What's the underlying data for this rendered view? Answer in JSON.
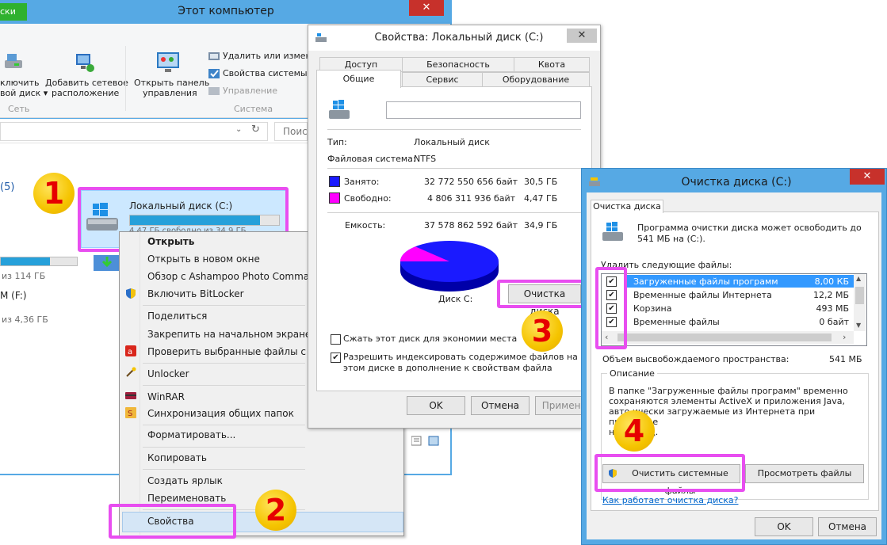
{
  "explorer": {
    "title": "Этот компьютер",
    "tab_partial": "ски",
    "ribbon": {
      "connect_label_1": "ключить",
      "connect_label_2": "вой диск ▾",
      "add_location_1": "Добавить сетевое",
      "add_location_2": "расположение",
      "open_panel_1": "Открыть панель",
      "open_panel_2": "управления",
      "uninstall": "Удалить или измени",
      "sys_props": "Свойства системы",
      "manage": "Управление",
      "group_net": "Сеть",
      "group_sys": "Система"
    },
    "search_placeholder": "Поис",
    "drives_count": "(5)",
    "drive_c_name": "Локальный диск (C:)",
    "drive_c_free": "4,47 ГБ свободно из 34,9 ГБ",
    "drive_left_free1": "из 114 ГБ",
    "drive_f": "M (F:)",
    "drive_left_free2": "из 4,36 ГБ"
  },
  "context_menu": {
    "items": [
      "Открыть",
      "Открыть в новом окне",
      "Обзор с Ashampoo Photo Command",
      "Включить BitLocker",
      "Поделиться",
      "Закрепить на начальном экране",
      "Проверить выбранные файлы с пом",
      "Unlocker",
      "WinRAR",
      "Синхронизация общих папок",
      "Форматировать...",
      "Копировать",
      "Создать ярлык",
      "Переименовать",
      "Свойства"
    ]
  },
  "properties": {
    "title": "Свойства: Локальный диск (C:)",
    "tabs": [
      "Доступ",
      "Безопасность",
      "Квота",
      "Общие",
      "Сервис",
      "Оборудование"
    ],
    "type_label": "Тип:",
    "type_value": "Локальный диск",
    "fs_label": "Файловая система:",
    "fs_value": "NTFS",
    "used_label": "Занято:",
    "used_bytes": "32 772 550 656 байт",
    "used_gb": "30,5 ГБ",
    "free_label": "Свободно:",
    "free_bytes": "4 806 311 936 байт",
    "free_gb": "4,47 ГБ",
    "capacity_label": "Емкость:",
    "capacity_bytes": "37 578 862 592 байт",
    "capacity_gb": "34,9 ГБ",
    "disk_label": "Диск C:",
    "cleanup_button": "Очистка диска",
    "compress_label": "Сжать этот диск для экономии места",
    "index_label": "Разрешить индексировать содержимое файлов на этом диске в дополнение к свойствам файла",
    "ok": "OK",
    "cancel": "Отмена",
    "apply": "Примени",
    "used_fraction": 0.872,
    "colors": {
      "used": "#1a1aff",
      "free": "#ff00ff"
    }
  },
  "cleanup": {
    "title": "Очистка диска  (C:)",
    "tab": "Очистка диска",
    "intro": "Программа очистки диска может освободить до 541 МБ на  (C:).",
    "delete_label": "Удалить следующие файлы:",
    "files": [
      {
        "name": "Загруженные файлы программ",
        "size": "8,00 КБ",
        "checked": "✔"
      },
      {
        "name": "Временные файлы Интернета",
        "size": "12,2 МБ",
        "checked": "✔"
      },
      {
        "name": "Корзина",
        "size": "493 МБ",
        "checked": "✔"
      },
      {
        "name": "Временные файлы",
        "size": "0 байт",
        "checked": "✔"
      }
    ],
    "total_label": "Объем высвобождаемого пространства:",
    "total_value": "541 МБ",
    "desc_title": "Описание",
    "desc_line1": "В папке \"Загруженные файлы программ\" временно",
    "desc_line2": "сохраняются элементы ActiveX и приложения Java,",
    "desc_line3": "авто     ически загружаемые из Интернета при просмотре",
    "desc_line4": "н        страниц.",
    "system_button": "Очистить системные файлы",
    "view_button": "Просмотреть файлы",
    "help_link": "Как работает очистка диска?",
    "ok": "OK",
    "cancel": "Отмена"
  },
  "badges": [
    "1",
    "2",
    "3",
    "4"
  ]
}
